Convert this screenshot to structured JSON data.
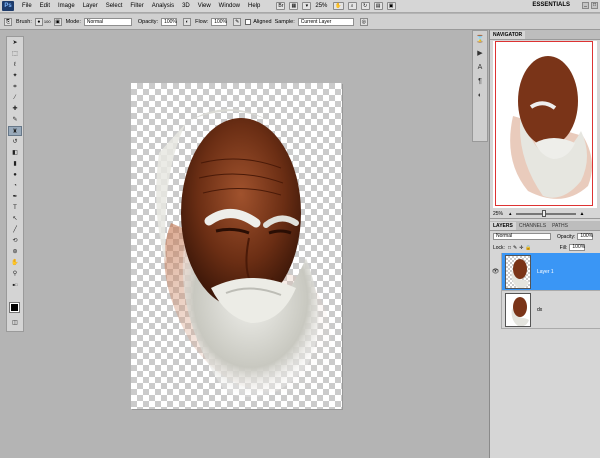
{
  "menubar": {
    "logo": "Ps",
    "menus": [
      "File",
      "Edit",
      "Image",
      "Layer",
      "Select",
      "Filter",
      "Analysis",
      "3D",
      "View",
      "Window",
      "Help"
    ],
    "zoom": "25%",
    "workspace": "ESSENTIALS"
  },
  "options": {
    "brush_label": "Brush:",
    "brush_size": "100",
    "mode_label": "Mode:",
    "mode_value": "Normal",
    "opacity_label": "Opacity:",
    "opacity_value": "100%",
    "flow_label": "Flow:",
    "flow_value": "100%",
    "aligned_label": "Aligned",
    "sample_label": "Sample:",
    "sample_value": "Current Layer"
  },
  "navigator": {
    "tab": "NAVIGATOR",
    "zoom": "25%"
  },
  "layers_panel": {
    "tabs": [
      "LAYERS",
      "CHANNELS",
      "PATHS"
    ],
    "blend_mode": "Normal",
    "opacity_label": "Opacity:",
    "opacity_value": "100%",
    "lock_label": "Lock:",
    "fill_label": "Fill:",
    "fill_value": "100%",
    "layers": [
      {
        "name": "Layer 1",
        "selected": true
      },
      {
        "name": "dx",
        "selected": false
      }
    ]
  },
  "colors": {
    "accent": "#3a96f5",
    "canvas_bg": "#b4b4b4"
  }
}
